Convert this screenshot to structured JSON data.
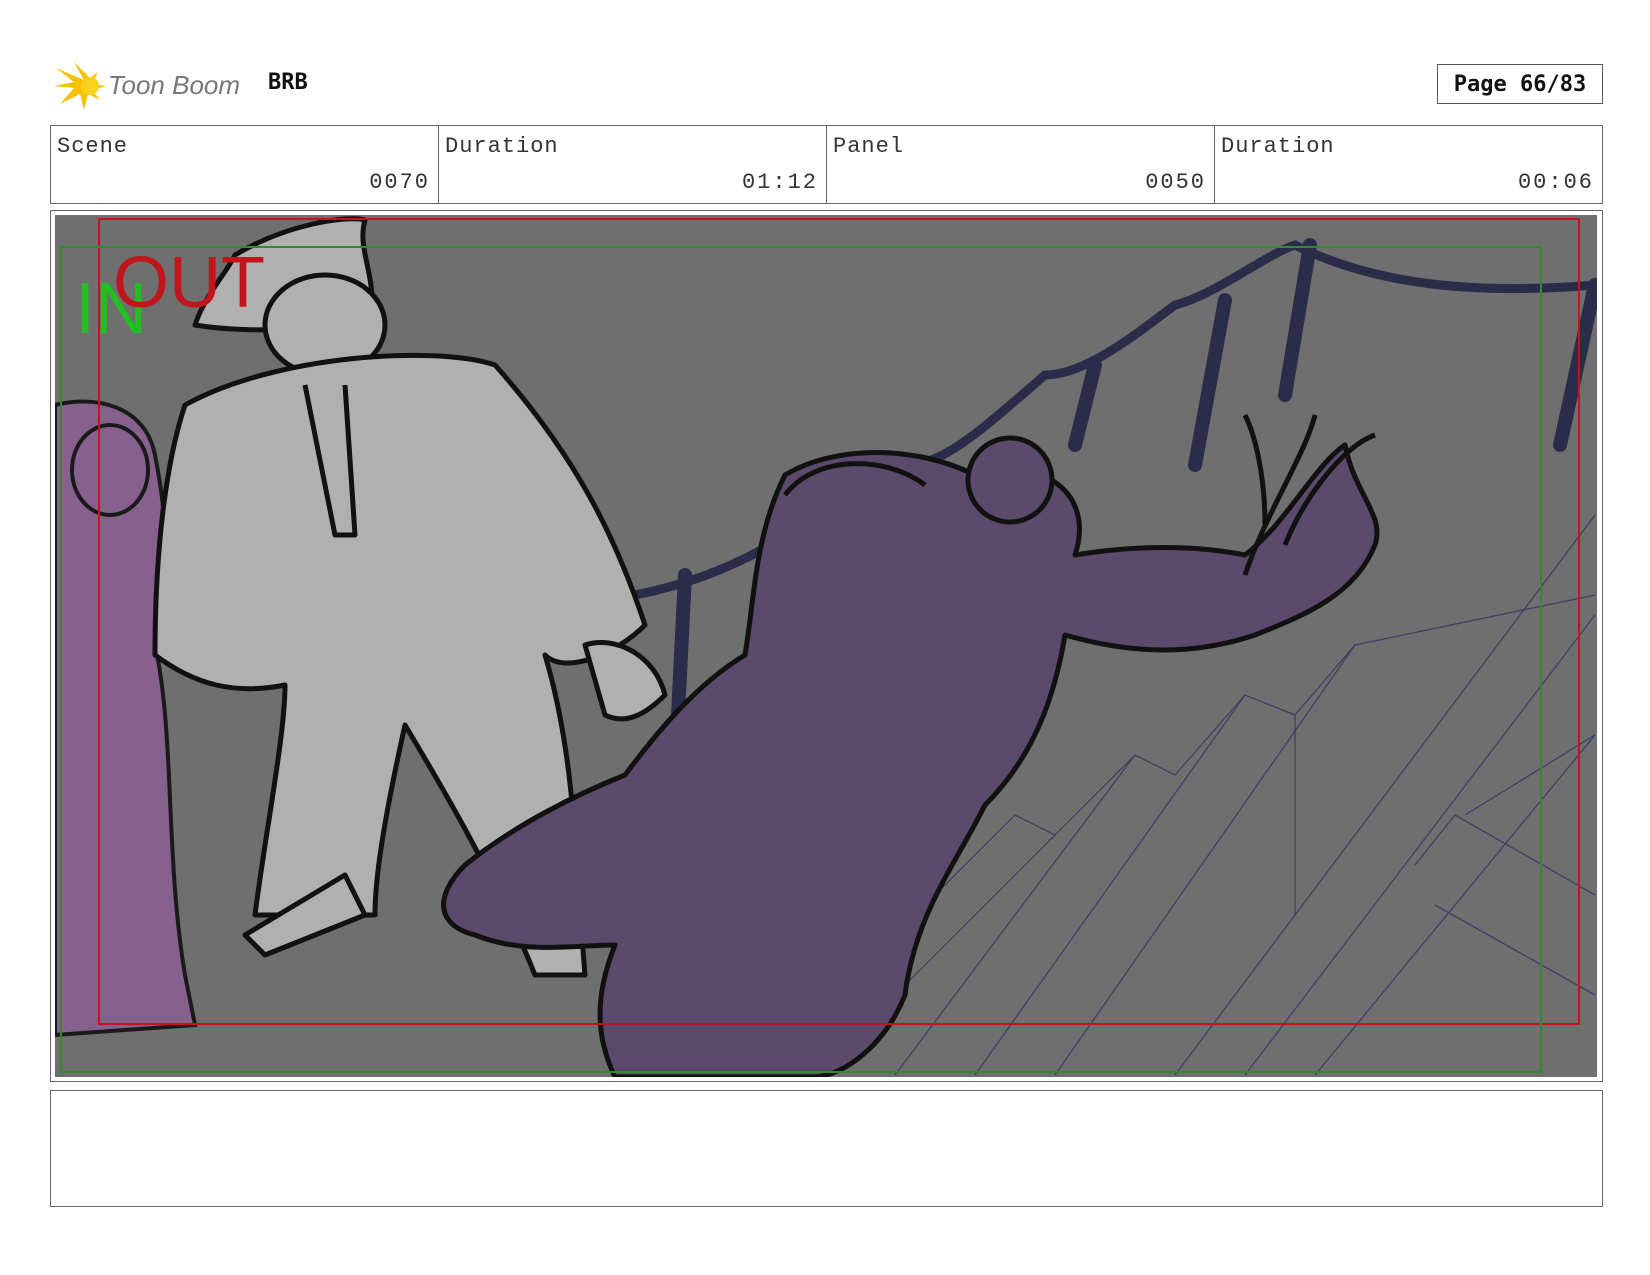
{
  "header": {
    "logo_text": "Toon Boom",
    "project": "BRB",
    "page": "Page 66/83"
  },
  "info": {
    "scene_label": "Scene",
    "scene_value": "0070",
    "scene_duration_label": "Duration",
    "scene_duration_value": "01:12",
    "panel_label": "Panel",
    "panel_value": "0050",
    "panel_duration_label": "Duration",
    "panel_duration_value": "00:06"
  },
  "panel": {
    "in_marker": "IN",
    "out_marker": "OUT",
    "colors": {
      "background": "#6f6f6f",
      "man_fill": "#b0b0b0",
      "woman_fill": "#5b4a6b",
      "girl_fill": "#86618e",
      "rope": "#2a2c4a",
      "in_frame": "#2e8b2e",
      "out_frame": "#c0161b"
    }
  },
  "caption": {
    "text": ""
  }
}
